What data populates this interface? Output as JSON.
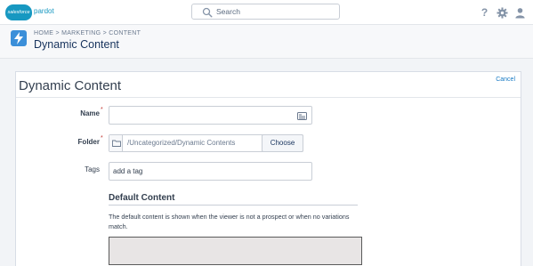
{
  "topbar": {
    "logo_text": "salesforce",
    "logo_sub": "pardot",
    "search_placeholder": "Search",
    "icons": [
      "help-icon",
      "gear-icon",
      "user-icon"
    ]
  },
  "header": {
    "breadcrumb": "HOME > MARKETING > CONTENT",
    "title": "Dynamic Content"
  },
  "panel": {
    "title": "Dynamic Content",
    "cancel_label": "Cancel"
  },
  "form": {
    "name_label": "Name",
    "name_value": "",
    "folder_label": "Folder",
    "folder_path": "/Uncategorized/Dynamic Contents",
    "choose_label": "Choose",
    "tags_label": "Tags",
    "tags_placeholder": "add a tag",
    "required_marker": "*"
  },
  "default_content": {
    "heading": "Default Content",
    "description": "The default content is shown when the viewer is not a prospect or when no variations match."
  },
  "colors": {
    "accent": "#1798c1",
    "link": "#1679c4",
    "required": "#c23934"
  }
}
